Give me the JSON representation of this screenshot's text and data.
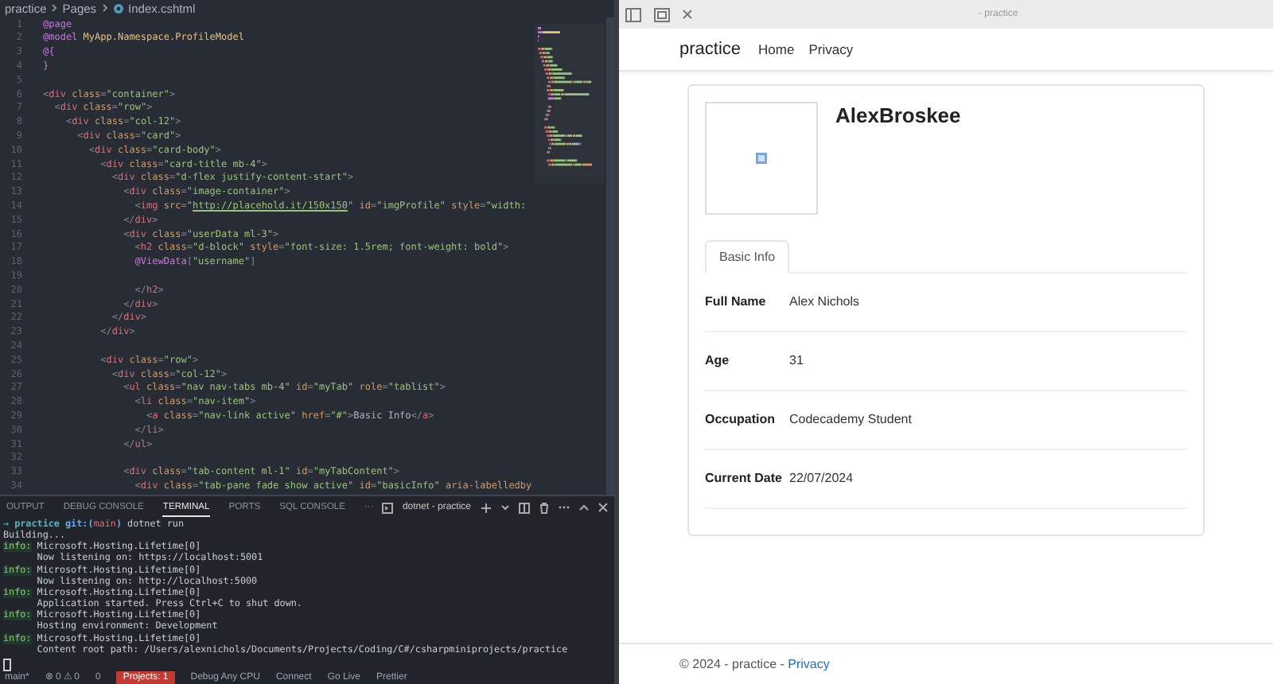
{
  "editor": {
    "breadcrumb": [
      "practice",
      "Pages",
      "Index.cshtml"
    ],
    "lines": [
      {
        "number": "1",
        "segments": [
          {
            "kind": "directive",
            "text": "@page"
          }
        ]
      },
      {
        "number": "2",
        "segments": [
          {
            "kind": "directive",
            "text": "@model "
          },
          {
            "kind": "type",
            "text": "MyApp.Namespace.ProfileModel"
          }
        ]
      },
      {
        "number": "3",
        "segments": [
          {
            "kind": "directive",
            "text": "@{"
          }
        ]
      },
      {
        "number": "4",
        "segments": [
          {
            "kind": "directive",
            "text": "}"
          }
        ]
      },
      {
        "number": "5"
      },
      {
        "number": "6",
        "segments": [
          {
            "kind": "punct",
            "text": "<"
          },
          {
            "kind": "tag",
            "text": "div"
          },
          {
            "kind": "attr",
            "text": " class"
          },
          {
            "kind": "punct",
            "text": "="
          },
          {
            "kind": "string",
            "text": "\"container\""
          },
          {
            "kind": "punct",
            "text": ">"
          }
        ]
      },
      {
        "number": "7",
        "segments": [
          {
            "kind": "punct",
            "text": "  <"
          },
          {
            "kind": "tag",
            "text": "div"
          },
          {
            "kind": "attr",
            "text": " class"
          },
          {
            "kind": "punct",
            "text": "="
          },
          {
            "kind": "string",
            "text": "\"row\""
          },
          {
            "kind": "punct",
            "text": ">"
          }
        ]
      },
      {
        "number": "8",
        "segments": [
          {
            "kind": "punct",
            "text": "    <"
          },
          {
            "kind": "tag",
            "text": "div"
          },
          {
            "kind": "attr",
            "text": " class"
          },
          {
            "kind": "punct",
            "text": "="
          },
          {
            "kind": "string",
            "text": "\"col-12\""
          },
          {
            "kind": "punct",
            "text": ">"
          }
        ]
      },
      {
        "number": "9",
        "segments": [
          {
            "kind": "punct",
            "text": "      <"
          },
          {
            "kind": "tag",
            "text": "div"
          },
          {
            "kind": "attr",
            "text": " class"
          },
          {
            "kind": "punct",
            "text": "="
          },
          {
            "kind": "string",
            "text": "\"card\""
          },
          {
            "kind": "punct",
            "text": ">"
          }
        ]
      },
      {
        "number": "10",
        "segments": [
          {
            "kind": "punct",
            "text": "        <"
          },
          {
            "kind": "tag",
            "text": "div"
          },
          {
            "kind": "attr",
            "text": " class"
          },
          {
            "kind": "punct",
            "text": "="
          },
          {
            "kind": "string",
            "text": "\"card-body\""
          },
          {
            "kind": "punct",
            "text": ">"
          }
        ]
      },
      {
        "number": "11",
        "segments": [
          {
            "kind": "punct",
            "text": "          <"
          },
          {
            "kind": "tag",
            "text": "div"
          },
          {
            "kind": "attr",
            "text": " class"
          },
          {
            "kind": "punct",
            "text": "="
          },
          {
            "kind": "string",
            "text": "\"card-title mb-4\""
          },
          {
            "kind": "punct",
            "text": ">"
          }
        ]
      },
      {
        "number": "12",
        "segments": [
          {
            "kind": "punct",
            "text": "            <"
          },
          {
            "kind": "tag",
            "text": "div"
          },
          {
            "kind": "attr",
            "text": " class"
          },
          {
            "kind": "punct",
            "text": "="
          },
          {
            "kind": "string",
            "text": "\"d-flex justify-content-start\""
          },
          {
            "kind": "punct",
            "text": ">"
          }
        ]
      },
      {
        "number": "13",
        "segments": [
          {
            "kind": "punct",
            "text": "              <"
          },
          {
            "kind": "tag",
            "text": "div"
          },
          {
            "kind": "attr",
            "text": " class"
          },
          {
            "kind": "punct",
            "text": "="
          },
          {
            "kind": "string",
            "text": "\"image-container\""
          },
          {
            "kind": "punct",
            "text": ">"
          }
        ]
      },
      {
        "number": "14",
        "segments": [
          {
            "kind": "punct",
            "text": "                <"
          },
          {
            "kind": "tag",
            "text": "img"
          },
          {
            "kind": "attr",
            "text": " src"
          },
          {
            "kind": "punct",
            "text": "="
          },
          {
            "kind": "string",
            "text": "\""
          },
          {
            "kind": "link",
            "text": "http://placehold.it/150x150"
          },
          {
            "kind": "string",
            "text": "\""
          },
          {
            "kind": "attr",
            "text": " id"
          },
          {
            "kind": "punct",
            "text": "="
          },
          {
            "kind": "string",
            "text": "\"imgProfile\""
          },
          {
            "kind": "attr",
            "text": " style"
          },
          {
            "kind": "punct",
            "text": "="
          },
          {
            "kind": "string",
            "text": "\"width:"
          }
        ]
      },
      {
        "number": "15",
        "segments": [
          {
            "kind": "punct",
            "text": "              </"
          },
          {
            "kind": "tag",
            "text": "div"
          },
          {
            "kind": "punct",
            "text": ">"
          }
        ]
      },
      {
        "number": "16",
        "segments": [
          {
            "kind": "punct",
            "text": "              <"
          },
          {
            "kind": "tag",
            "text": "div"
          },
          {
            "kind": "attr",
            "text": " class"
          },
          {
            "kind": "punct",
            "text": "="
          },
          {
            "kind": "string",
            "text": "\"userData ml-3\""
          },
          {
            "kind": "punct",
            "text": ">"
          }
        ]
      },
      {
        "number": "17",
        "segments": [
          {
            "kind": "punct",
            "text": "                <"
          },
          {
            "kind": "tag",
            "text": "h2"
          },
          {
            "kind": "attr",
            "text": " class"
          },
          {
            "kind": "punct",
            "text": "="
          },
          {
            "kind": "string",
            "text": "\"d-block\""
          },
          {
            "kind": "attr",
            "text": " style"
          },
          {
            "kind": "punct",
            "text": "="
          },
          {
            "kind": "string",
            "text": "\"font-size: 1.5rem; font-weight: bold\""
          },
          {
            "kind": "punct",
            "text": ">"
          }
        ]
      },
      {
        "number": "18",
        "segments": [
          {
            "kind": "directive",
            "text": "                @ViewData"
          },
          {
            "kind": "punct",
            "text": "["
          },
          {
            "kind": "string",
            "text": "\"username\""
          },
          {
            "kind": "punct",
            "text": "]"
          }
        ]
      },
      {
        "number": "19"
      },
      {
        "number": "20",
        "segments": [
          {
            "kind": "punct",
            "text": "                </"
          },
          {
            "kind": "tag",
            "text": "h2"
          },
          {
            "kind": "punct",
            "text": ">"
          }
        ]
      },
      {
        "number": "21",
        "segments": [
          {
            "kind": "punct",
            "text": "              </"
          },
          {
            "kind": "tag",
            "text": "div"
          },
          {
            "kind": "punct",
            "text": ">"
          }
        ]
      },
      {
        "number": "22",
        "segments": [
          {
            "kind": "punct",
            "text": "            </"
          },
          {
            "kind": "tag",
            "text": "div"
          },
          {
            "kind": "punct",
            "text": ">"
          }
        ]
      },
      {
        "number": "23",
        "segments": [
          {
            "kind": "punct",
            "text": "          </"
          },
          {
            "kind": "tag",
            "text": "div"
          },
          {
            "kind": "punct",
            "text": ">"
          }
        ]
      },
      {
        "number": "24"
      },
      {
        "number": "25",
        "segments": [
          {
            "kind": "punct",
            "text": "          <"
          },
          {
            "kind": "tag",
            "text": "div"
          },
          {
            "kind": "attr",
            "text": " class"
          },
          {
            "kind": "punct",
            "text": "="
          },
          {
            "kind": "string",
            "text": "\"row\""
          },
          {
            "kind": "punct",
            "text": ">"
          }
        ]
      },
      {
        "number": "26",
        "segments": [
          {
            "kind": "punct",
            "text": "            <"
          },
          {
            "kind": "tag",
            "text": "div"
          },
          {
            "kind": "attr",
            "text": " class"
          },
          {
            "kind": "punct",
            "text": "="
          },
          {
            "kind": "string",
            "text": "\"col-12\""
          },
          {
            "kind": "punct",
            "text": ">"
          }
        ]
      },
      {
        "number": "27",
        "segments": [
          {
            "kind": "punct",
            "text": "              <"
          },
          {
            "kind": "tag",
            "text": "ul"
          },
          {
            "kind": "attr",
            "text": " class"
          },
          {
            "kind": "punct",
            "text": "="
          },
          {
            "kind": "string",
            "text": "\"nav nav-tabs mb-4\""
          },
          {
            "kind": "attr",
            "text": " id"
          },
          {
            "kind": "punct",
            "text": "="
          },
          {
            "kind": "string",
            "text": "\"myTab\""
          },
          {
            "kind": "attr",
            "text": " role"
          },
          {
            "kind": "punct",
            "text": "="
          },
          {
            "kind": "string",
            "text": "\"tablist\""
          },
          {
            "kind": "punct",
            "text": ">"
          }
        ]
      },
      {
        "number": "28",
        "segments": [
          {
            "kind": "punct",
            "text": "                <"
          },
          {
            "kind": "tag",
            "text": "li"
          },
          {
            "kind": "attr",
            "text": " class"
          },
          {
            "kind": "punct",
            "text": "="
          },
          {
            "kind": "string",
            "text": "\"nav-item\""
          },
          {
            "kind": "punct",
            "text": ">"
          }
        ]
      },
      {
        "number": "29",
        "segments": [
          {
            "kind": "punct",
            "text": "                  <"
          },
          {
            "kind": "tag",
            "text": "a"
          },
          {
            "kind": "attr",
            "text": " class"
          },
          {
            "kind": "punct",
            "text": "="
          },
          {
            "kind": "string",
            "text": "\"nav-link active\""
          },
          {
            "kind": "attr",
            "text": " href"
          },
          {
            "kind": "punct",
            "text": "="
          },
          {
            "kind": "string",
            "text": "\"#\""
          },
          {
            "kind": "punct",
            "text": ">"
          },
          {
            "kind": "text",
            "text": "Basic Info"
          },
          {
            "kind": "punct",
            "text": "</"
          },
          {
            "kind": "tag",
            "text": "a"
          },
          {
            "kind": "punct",
            "text": ">"
          }
        ]
      },
      {
        "number": "30",
        "segments": [
          {
            "kind": "punct",
            "text": "                </"
          },
          {
            "kind": "tag",
            "text": "li"
          },
          {
            "kind": "punct",
            "text": ">"
          }
        ]
      },
      {
        "number": "31",
        "segments": [
          {
            "kind": "punct",
            "text": "              </"
          },
          {
            "kind": "tag",
            "text": "ul"
          },
          {
            "kind": "punct",
            "text": ">"
          }
        ]
      },
      {
        "number": "32"
      },
      {
        "number": "33",
        "segments": [
          {
            "kind": "punct",
            "text": "              <"
          },
          {
            "kind": "tag",
            "text": "div"
          },
          {
            "kind": "attr",
            "text": " class"
          },
          {
            "kind": "punct",
            "text": "="
          },
          {
            "kind": "string",
            "text": "\"tab-content ml-1\""
          },
          {
            "kind": "attr",
            "text": " id"
          },
          {
            "kind": "punct",
            "text": "="
          },
          {
            "kind": "string",
            "text": "\"myTabContent\""
          },
          {
            "kind": "punct",
            "text": ">"
          }
        ]
      },
      {
        "number": "34",
        "segments": [
          {
            "kind": "punct",
            "text": "                <"
          },
          {
            "kind": "tag",
            "text": "div"
          },
          {
            "kind": "attr",
            "text": " class"
          },
          {
            "kind": "punct",
            "text": "="
          },
          {
            "kind": "string",
            "text": "\"tab-pane fade show active\""
          },
          {
            "kind": "attr",
            "text": " id"
          },
          {
            "kind": "punct",
            "text": "="
          },
          {
            "kind": "string",
            "text": "\"basicInfo\""
          },
          {
            "kind": "attr",
            "text": " aria-labelledby"
          }
        ]
      }
    ]
  },
  "panel": {
    "tabs": [
      {
        "label": "OUTPUT",
        "selected": false
      },
      {
        "label": "DEBUG CONSOLE",
        "selected": false
      },
      {
        "label": "TERMINAL",
        "selected": true
      },
      {
        "label": "PORTS",
        "selected": false
      },
      {
        "label": "SQL CONSOLE",
        "selected": false
      }
    ],
    "more": "···",
    "terminal_name": "dotnet - practice",
    "terminal_lines": [
      {
        "segments": [
          {
            "kind": "arrow",
            "text": "→ "
          },
          {
            "kind": "dir",
            "text": "practice "
          },
          {
            "kind": "git",
            "text": "git:("
          },
          {
            "kind": "branch",
            "text": "main"
          },
          {
            "kind": "git",
            "text": ")"
          },
          {
            "kind": "plain",
            "text": " dotnet run"
          }
        ]
      },
      {
        "segments": [
          {
            "kind": "plain",
            "text": "Building..."
          }
        ]
      },
      {
        "segments": [
          {
            "kind": "info",
            "text": "info:"
          },
          {
            "kind": "plain",
            "text": " Microsoft.Hosting.Lifetime[0]"
          }
        ]
      },
      {
        "segments": [
          {
            "kind": "plain",
            "text": "      Now listening on: https://localhost:5001"
          }
        ]
      },
      {
        "segments": [
          {
            "kind": "info",
            "text": "info:"
          },
          {
            "kind": "plain",
            "text": " Microsoft.Hosting.Lifetime[0]"
          }
        ]
      },
      {
        "segments": [
          {
            "kind": "plain",
            "text": "      Now listening on: http://localhost:5000"
          }
        ]
      },
      {
        "segments": [
          {
            "kind": "info",
            "text": "info:"
          },
          {
            "kind": "plain",
            "text": " Microsoft.Hosting.Lifetime[0]"
          }
        ]
      },
      {
        "segments": [
          {
            "kind": "plain",
            "text": "      Application started. Press Ctrl+C to shut down."
          }
        ]
      },
      {
        "segments": [
          {
            "kind": "info",
            "text": "info:"
          },
          {
            "kind": "plain",
            "text": " Microsoft.Hosting.Lifetime[0]"
          }
        ]
      },
      {
        "segments": [
          {
            "kind": "plain",
            "text": "      Hosting environment: Development"
          }
        ]
      },
      {
        "segments": [
          {
            "kind": "info",
            "text": "info:"
          },
          {
            "kind": "plain",
            "text": " Microsoft.Hosting.Lifetime[0]"
          }
        ]
      },
      {
        "segments": [
          {
            "kind": "plain",
            "text": "      Content root path: /Users/alexnichols/Documents/Projects/Coding/C#/csharpminiprojects/practice"
          }
        ]
      }
    ]
  },
  "status_bar": [
    {
      "kind": "plain",
      "text": "main*"
    },
    {
      "kind": "plain",
      "text": "⊗ 0 ⚠ 0"
    },
    {
      "kind": "plain",
      "text": "0"
    },
    {
      "kind": "alert",
      "text": "Projects: 1"
    },
    {
      "kind": "plain",
      "text": "Debug Any CPU"
    },
    {
      "kind": "plain",
      "text": "Connect"
    },
    {
      "kind": "plain",
      "text": "Go Live"
    },
    {
      "kind": "plain",
      "text": "Prettier"
    }
  ],
  "browser": {
    "title": "- practice",
    "navbar": {
      "brand": "practice",
      "links": [
        "Home",
        "Privacy"
      ]
    },
    "profile": {
      "name": "AlexBroskee",
      "tabs": [
        {
          "label": "Basic Info",
          "selected": true
        }
      ],
      "rows": [
        {
          "label": "Full Name",
          "value": "Alex Nichols"
        },
        {
          "label": "Age",
          "value": "31"
        },
        {
          "label": "Occupation",
          "value": "Codecademy Student"
        },
        {
          "label": "Current Date",
          "value": "22/07/2024"
        }
      ]
    },
    "footer": {
      "text": "© 2024 - practice - ",
      "link": "Privacy"
    }
  }
}
